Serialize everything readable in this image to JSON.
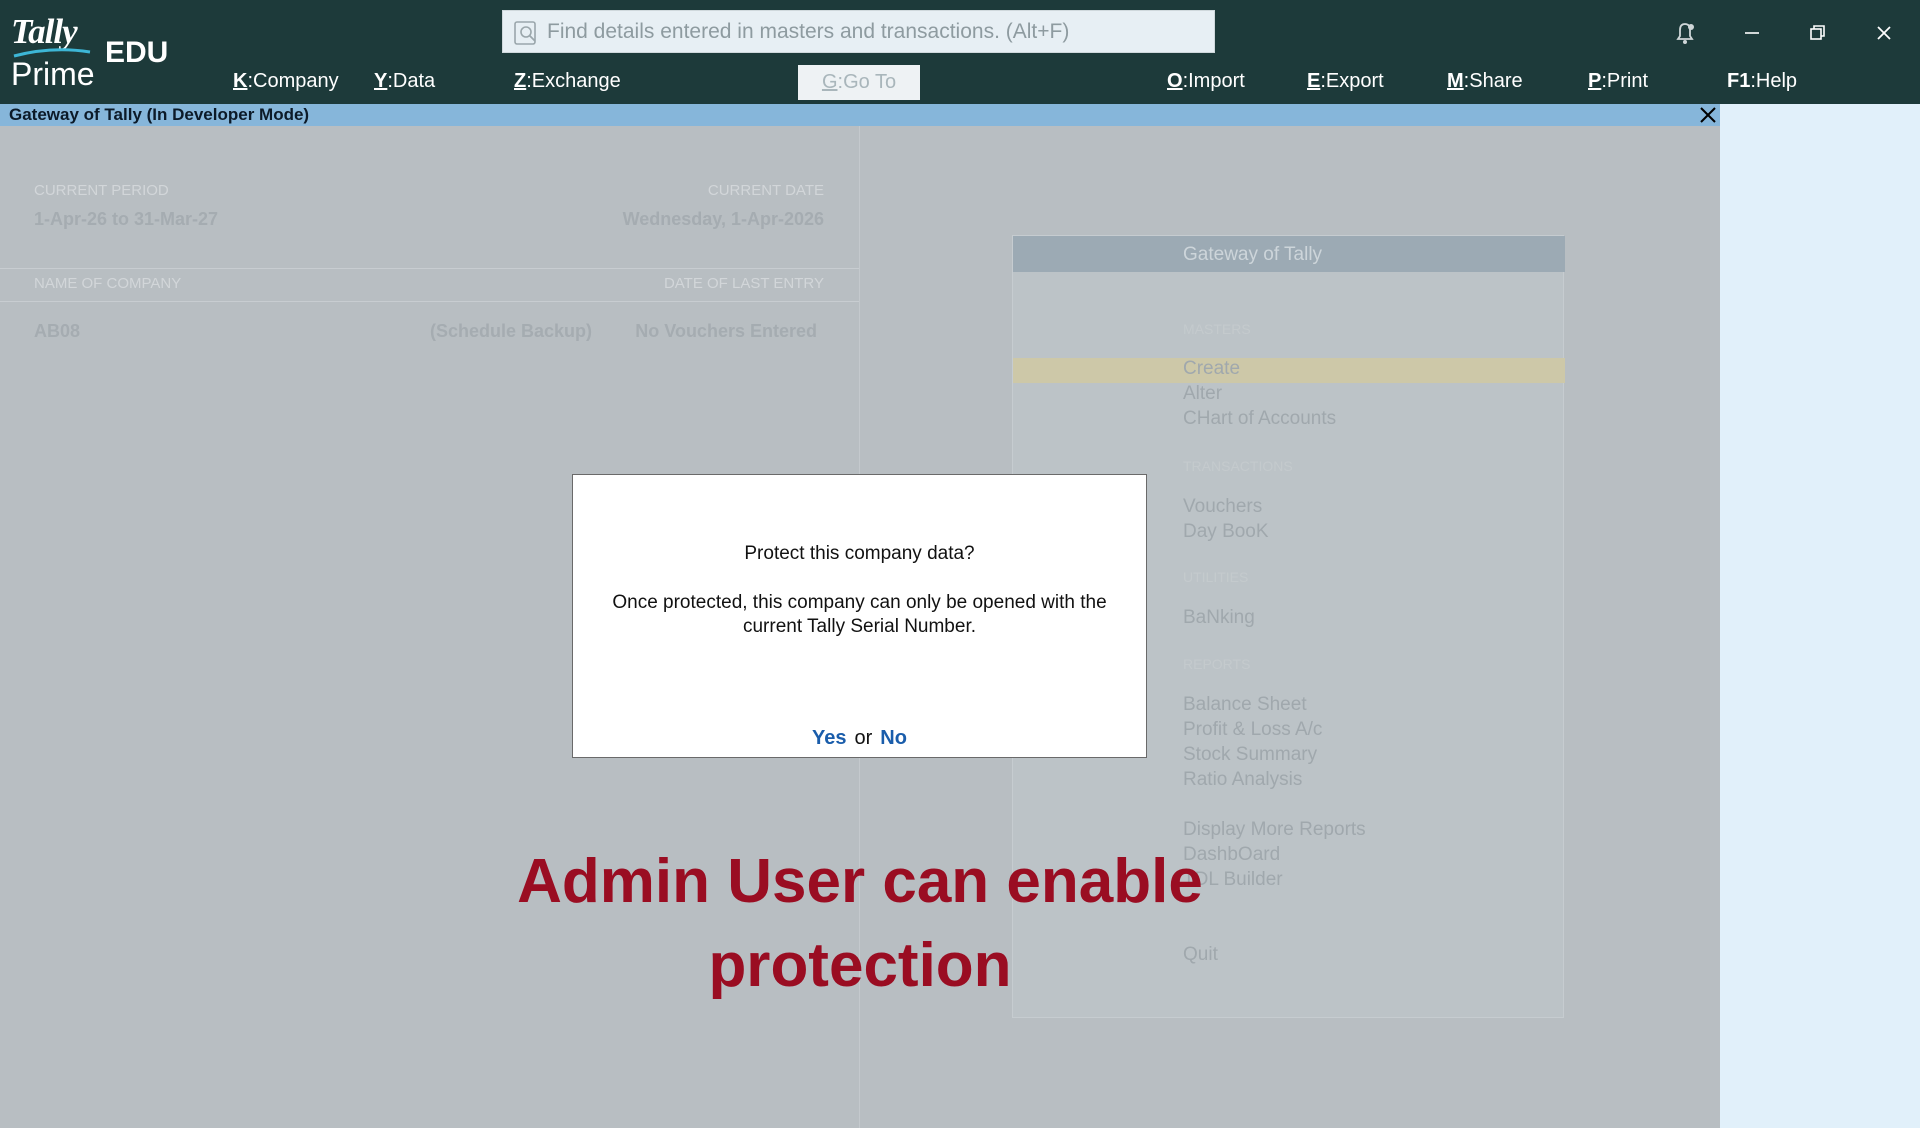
{
  "app": {
    "logo_word": "Tally",
    "product": "Prime",
    "edition": "EDU"
  },
  "search": {
    "placeholder": "Find details entered in masters and transactions. (Alt+F)"
  },
  "menu": [
    {
      "key": "K",
      "label": "Company"
    },
    {
      "key": "Y",
      "label": "Data"
    },
    {
      "key": "Z",
      "label": "Exchange"
    },
    {
      "key": "G",
      "label": "Go To"
    },
    {
      "key": "O",
      "label": "Import"
    },
    {
      "key": "E",
      "label": "Export"
    },
    {
      "key": "M",
      "label": "Share"
    },
    {
      "key": "P",
      "label": "Print"
    },
    {
      "key": "F1",
      "label": "Help"
    }
  ],
  "window": {
    "title": "Gateway of Tally (In Developer Mode)"
  },
  "company_info": {
    "current_period_label": "CURRENT PERIOD",
    "current_period": "1-Apr-26 to 31-Mar-27",
    "current_date_label": "CURRENT DATE",
    "current_date": "Wednesday, 1-Apr-2026",
    "name_label": "NAME OF COMPANY",
    "last_entry_label": "DATE OF LAST ENTRY",
    "company_name": "AB08",
    "schedule": "(Schedule Backup)",
    "last_entry": "No Vouchers Entered"
  },
  "gateway": {
    "title": "Gateway of Tally",
    "sections": {
      "masters": "MASTERS",
      "transactions": "TRANSACTIONS",
      "utilities": "UTILITIES",
      "reports": "REPORTS"
    },
    "items": {
      "create": "Create",
      "alter": "Alter",
      "chart": "CHart of Accounts",
      "vouchers": "Vouchers",
      "daybook": "Day BooK",
      "banking": "BaNking",
      "balance_sheet": "Balance Sheet",
      "pl": "Profit & Loss A/c",
      "stock": "Stock Summary",
      "ratio": "Ratio Analysis",
      "more_reports": "Display More Reports",
      "dashboard": "DashbOard",
      "tdl": "TDL Builder",
      "quit": "Quit"
    }
  },
  "dialog": {
    "question": "Protect this company data?",
    "message": "Once protected, this company can only be opened with the current Tally Serial Number.",
    "yes": "Yes",
    "or": "or",
    "no": "No"
  },
  "caption": {
    "line1": "Admin User can enable",
    "line2": "protection"
  },
  "colors": {
    "topbar": "#1d3a3a",
    "titlebar": "#86b6da",
    "link": "#1a5dab",
    "caption": "#9a0d22"
  }
}
